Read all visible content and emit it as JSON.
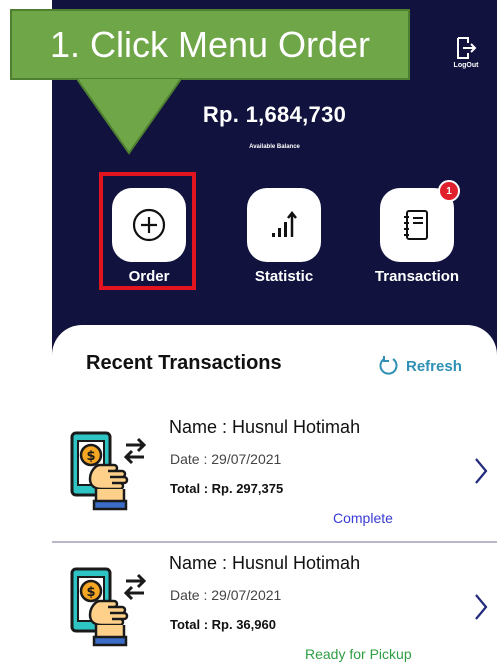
{
  "colors": {
    "phone_bg": "#11123d",
    "callout_bg": "#6fa648",
    "highlight": "#e2141f",
    "badge": "#e0202a",
    "refresh": "#2f8fb5",
    "status_complete": "#3a3ad6",
    "status_ready": "#2e9e44",
    "chevron": "#1f2a7a"
  },
  "callout": {
    "text": "1. Click Menu Order"
  },
  "header": {
    "logout_label": "LogOut",
    "balance": "Rp. 1,684,730",
    "balance_caption": "Available Balance"
  },
  "menu": [
    {
      "label": "Order",
      "icon": "plus-circle-icon"
    },
    {
      "label": "Statistic",
      "icon": "bar-chart-icon"
    },
    {
      "label": "Transaction",
      "icon": "notebook-icon",
      "badge": "1"
    }
  ],
  "recent": {
    "title": "Recent Transactions",
    "refresh_label": "Refresh",
    "items": [
      {
        "name": "Name : Husnul Hotimah",
        "date": "Date : 29/07/2021",
        "total": "Total : Rp. 297,375",
        "status": "Complete"
      },
      {
        "name": "Name : Husnul Hotimah",
        "date": "Date : 29/07/2021",
        "total": "Total : Rp. 36,960",
        "status": "Ready for Pickup"
      }
    ]
  }
}
